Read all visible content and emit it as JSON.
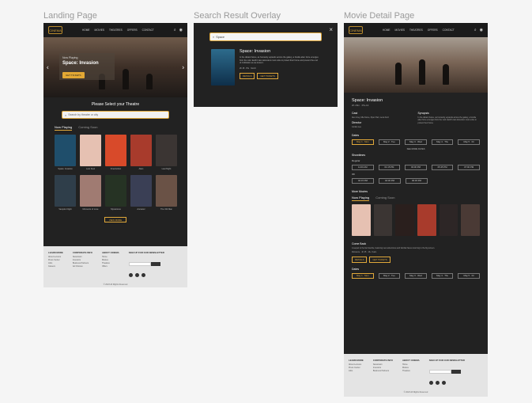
{
  "frames": {
    "landing": {
      "title": "Landing Page"
    },
    "overlay": {
      "title": "Search Result Overlay"
    },
    "detail": {
      "title": "Movie Detail Page"
    }
  },
  "nav": {
    "logo": "CINEMA",
    "links": [
      "HOME",
      "MOVIES",
      "THEATRES",
      "OFFERS",
      "CONTACT"
    ]
  },
  "landing": {
    "hero_small": "Now Playing",
    "hero_title": "Space: Invasion",
    "hero_button": "GET TICKETS",
    "select_title": "Please Select your Theatre",
    "search_placeholder": "Search by theatre or city",
    "tab_now": "Now Playing",
    "tab_soon": "Coming Soon",
    "posters_row1": [
      {
        "label": "Space: Invasion",
        "color": "#1f4e6b"
      },
      {
        "label": "Lost Soul",
        "color": "#e6c1b2"
      },
      {
        "label": "Final Action",
        "color": "#d84a2a"
      },
      {
        "label": "Alien",
        "color": "#a83b2c"
      },
      {
        "label": "Last Night",
        "color": "#3b3533"
      }
    ],
    "posters_row2": [
      {
        "label": "Vampire Night",
        "color": "#2f3e4a"
      },
      {
        "label": "Moments of Love",
        "color": "#a07b72"
      },
      {
        "label": "Mysterious",
        "color": "#263324"
      },
      {
        "label": "Ancestor",
        "color": "#3a3f55"
      },
      {
        "label": "The Old Man",
        "color": "#6a5246"
      }
    ],
    "view_more": "VIEW MORE"
  },
  "footer": {
    "cols": [
      {
        "head": "LEARN MORE",
        "items": [
          "About Lemons",
          "Press Center",
          "Jobs",
          "Careers"
        ]
      },
      {
        "head": "CORPORATE INFO",
        "items": [
          "Newsroom",
          "Investors",
          "Business Partners",
          "Ad Choices"
        ]
      },
      {
        "head": "ABOUT CINEMA",
        "items": [
          "Home",
          "Movies",
          "Theatres",
          "Offers"
        ]
      }
    ],
    "newsletter": "SIGN UP FOR OUR NEWSLETTER",
    "legal": "© 2023 All Rights Reserved"
  },
  "overlay": {
    "search_value": "Space",
    "result_title": "Space: Invasion",
    "result_desc": "In the distant future, as humanity expands across the galaxy, a hostile alien force emerges from the void. Earth's last defenders must unite to protect their home and prevent the end of civilization as we know it.",
    "meta": "2h 15 · PG · Sci-Fi",
    "btn_details": "DETAILS",
    "btn_tickets": "GET TICKETS"
  },
  "detail": {
    "title": "Space: Invasion",
    "sub": "2h 15m · PG-13",
    "cast_h": "Cast",
    "cast": "Alex Grey, Mia Stone, Ryan Hart, Lena Ford",
    "director_h": "Director",
    "director": "Jordan Lee",
    "synopsis_h": "Synopsis",
    "synopsis": "In the distant future, as humanity expands across the galaxy, a hostile alien force emerges from the void. Earth's last defenders must unite to protect their home.",
    "dates_h": "Dates",
    "dates": [
      "May 1 · Mon",
      "May 2 · Tue",
      "May 3 · Wed",
      "May 4 · Thu",
      "May 5 · Fri"
    ],
    "see_more": "SEE MORE DATES",
    "showtimes_h": "Showtimes",
    "regular": "Regular",
    "times1": [
      "11:00 AM",
      "01:15 PM",
      "03:30 PM",
      "05:45 PM",
      "07:00 PM"
    ],
    "vip": "3D",
    "times2": [
      "02:15 PM",
      "04:30 PM",
      "06:45 PM"
    ],
    "more_h": "More Movies",
    "tab_now": "Now Playing",
    "tab_soon": "Coming Soon",
    "come_back_h": "Come Back",
    "come_back_text": "A sequel to the fan favorite, featuring new adventures and familiar faces returning to the big screen.",
    "come_meta": "Romance · 1h 45 · 13+ Years",
    "btn_details": "DETAILS",
    "btn_tickets": "GET TICKETS",
    "dates2": [
      "May 1 · Mon",
      "May 2 · Tue",
      "May 3 · Wed",
      "May 4 · Thu",
      "May 5 · Fri"
    ],
    "mm_posters": [
      {
        "color": "#e6c1b2"
      },
      {
        "color": "#3b3533"
      },
      {
        "color": "#2a1f1d"
      },
      {
        "color": "#a83b2c"
      },
      {
        "color": "#2d2626"
      },
      {
        "color": "#4a3a35"
      }
    ]
  }
}
